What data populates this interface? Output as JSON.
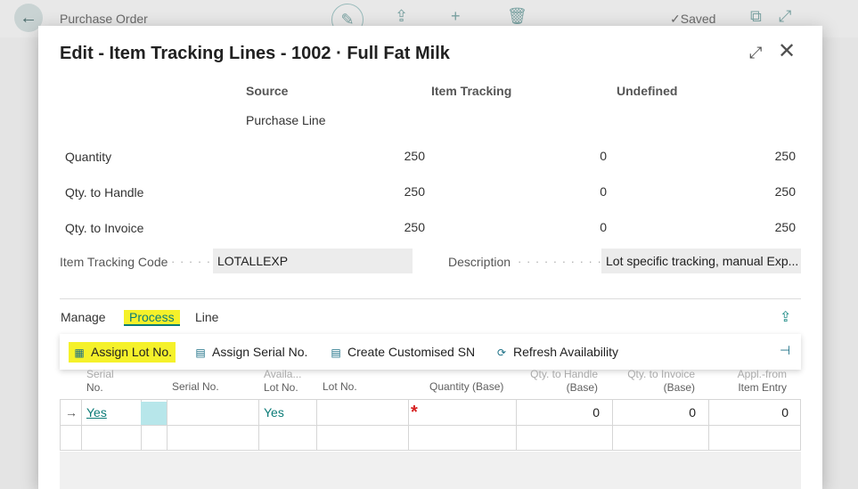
{
  "background": {
    "page_title": "Purchase Order",
    "saved_label": "✓Saved"
  },
  "dialog": {
    "title": "Edit - Item Tracking Lines - 1002 · Full Fat Milk",
    "columns": {
      "source": "Source",
      "item_tracking": "Item Tracking",
      "undefined": "Undefined"
    },
    "source_sub": "Purchase Line",
    "rows": [
      {
        "label": "Quantity",
        "source": "250",
        "tracking": "0",
        "undefined": "250"
      },
      {
        "label": "Qty. to Handle",
        "source": "250",
        "tracking": "0",
        "undefined": "250"
      },
      {
        "label": "Qty. to Invoice",
        "source": "250",
        "tracking": "0",
        "undefined": "250"
      }
    ],
    "item_tracking_code_label": "Item Tracking Code",
    "item_tracking_code_value": "LOTALLEXP",
    "description_label": "Description",
    "description_value": "Lot specific tracking, manual Exp..."
  },
  "tabs": [
    "Manage",
    "Process",
    "Line"
  ],
  "actions": {
    "assign_lot": "Assign Lot No.",
    "assign_serial": "Assign Serial No.",
    "create_customised": "Create Customised SN",
    "refresh": "Refresh Availability"
  },
  "grid": {
    "headers": {
      "serial_no_a": "Serial",
      "serial_no_b": "No.",
      "serial_no": "Serial No.",
      "avail_a": "Availa...",
      "avail_b": "Lot No.",
      "lot_no": "Lot No.",
      "qty_base": "Quantity (Base)",
      "qty_handle_a": "Qty. to Handle",
      "qty_handle_b": "(Base)",
      "qty_invoice_a": "Qty. to Invoice",
      "qty_invoice_b": "(Base)",
      "appl_a": "Appl.-from",
      "appl_b": "Item Entry"
    },
    "row": {
      "serial": "Yes",
      "lot_avail": "Yes",
      "qty_handle": "0",
      "qty_invoice": "0",
      "appl_from": "0"
    }
  }
}
